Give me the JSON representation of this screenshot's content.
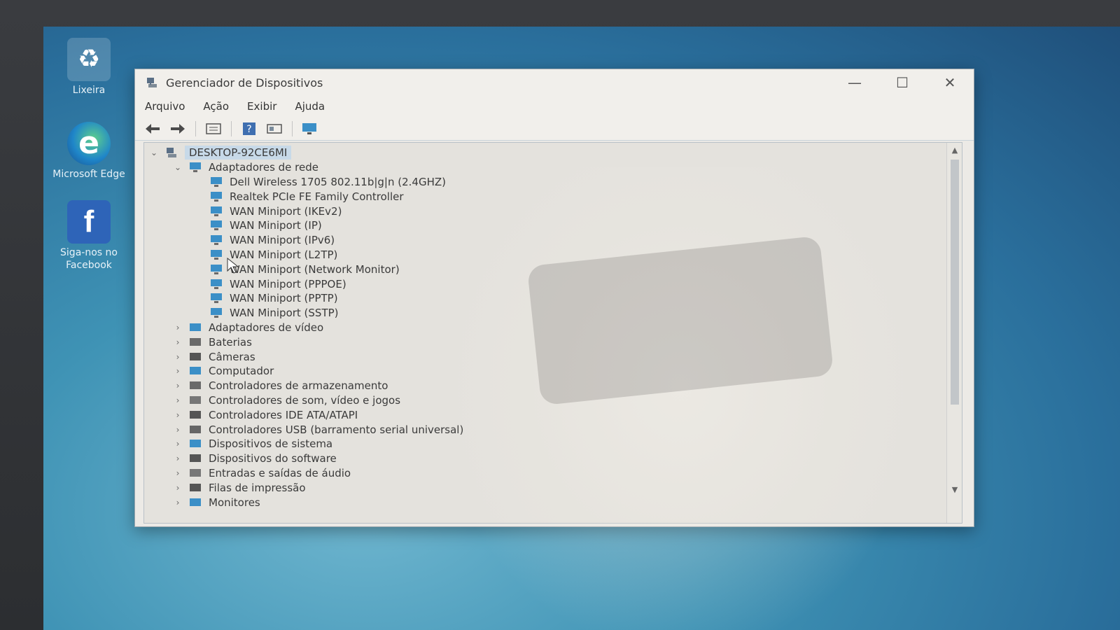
{
  "desktop": {
    "icons": [
      {
        "label": "Lixeira",
        "icon": "recycle-bin-icon"
      },
      {
        "label": "Microsoft Edge",
        "icon": "edge-icon"
      },
      {
        "label": "Siga-nos no Facebook",
        "icon": "facebook-icon"
      }
    ]
  },
  "window": {
    "title": "Gerenciador de Dispositivos",
    "controls": {
      "minimize": "—",
      "maximize": "☐",
      "close": "✕"
    },
    "menu": [
      "Arquivo",
      "Ação",
      "Exibir",
      "Ajuda"
    ],
    "toolbar": [
      "back-icon",
      "forward-icon",
      "properties-icon",
      "help-icon",
      "view-icon",
      "monitor-icon"
    ]
  },
  "tree": {
    "root": "DESKTOP-92CE6MI",
    "expanded_category": "Adaptadores de rede",
    "network_adapters": [
      "Dell Wireless 1705 802.11b|g|n (2.4GHZ)",
      "Realtek PCIe FE Family Controller",
      "WAN Miniport (IKEv2)",
      "WAN Miniport (IP)",
      "WAN Miniport (IPv6)",
      "WAN Miniport (L2TP)",
      "WAN Miniport (Network Monitor)",
      "WAN Miniport (PPPOE)",
      "WAN Miniport (PPTP)",
      "WAN Miniport (SSTP)"
    ],
    "categories": [
      "Adaptadores de vídeo",
      "Baterias",
      "Câmeras",
      "Computador",
      "Controladores de armazenamento",
      "Controladores de som, vídeo e jogos",
      "Controladores IDE ATA/ATAPI",
      "Controladores USB (barramento serial universal)",
      "Dispositivos de sistema",
      "Dispositivos do software",
      "Entradas e saídas de áudio",
      "Filas de impressão",
      "Monitores"
    ]
  },
  "colors": {
    "window_bg": "#eceae6",
    "selection": "#c7d9e8",
    "desktop": "#3f93b5"
  }
}
